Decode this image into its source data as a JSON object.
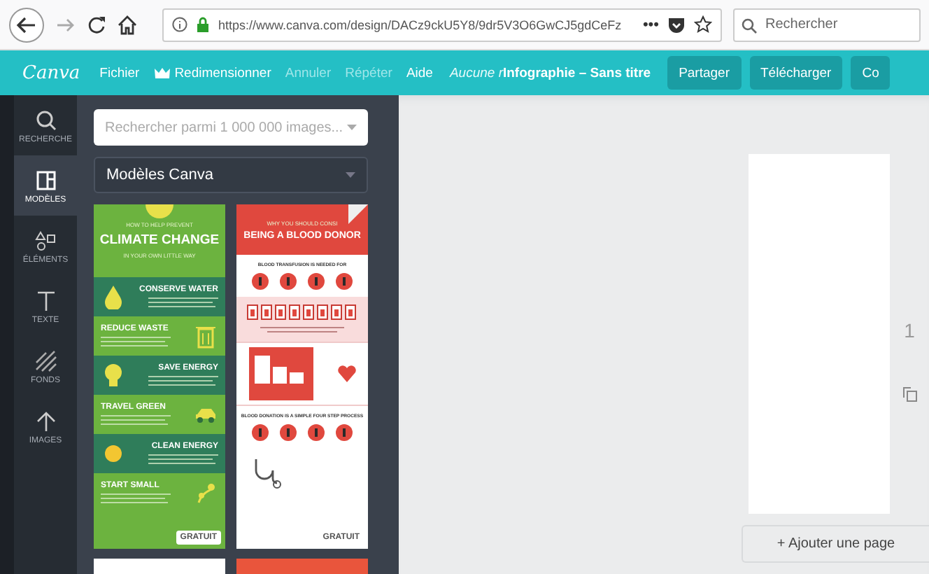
{
  "browser": {
    "url": "https://www.canva.com/design/DACz9ckU5Y8/9dr5V3O6GwCJ5gdCeFz",
    "more": "•••",
    "search": {
      "placeholder": "Rechercher"
    }
  },
  "header": {
    "logo": "Canva",
    "menu": [
      {
        "label": "Fichier",
        "disabled": false,
        "kind": "text"
      },
      {
        "label": "Redimensionner",
        "disabled": false,
        "kind": "crown"
      },
      {
        "label": "Annuler",
        "disabled": true,
        "kind": "text"
      },
      {
        "label": "Répéter",
        "disabled": true,
        "kind": "text"
      },
      {
        "label": "Aide",
        "disabled": false,
        "kind": "text"
      }
    ],
    "hint": "Aucune r",
    "title": "Infographie – Sans titre",
    "buttons": [
      "Partager",
      "Télécharger",
      "Co"
    ]
  },
  "sidebar": {
    "items": [
      {
        "label": "RECHERCHE",
        "kind": "search",
        "selected": false
      },
      {
        "label": "MODÈLES",
        "kind": "layout",
        "selected": true
      },
      {
        "label": "ÉLÉMENTS",
        "kind": "shapes",
        "selected": false
      },
      {
        "label": "TEXTE",
        "kind": "text",
        "selected": false
      },
      {
        "label": "FONDS",
        "kind": "hatch",
        "selected": false
      },
      {
        "label": "IMAGES",
        "kind": "upload",
        "selected": false
      }
    ]
  },
  "panel": {
    "search": {
      "placeholder": "Rechercher parmi 1 000 000 images..."
    },
    "category": "Modèles Canva",
    "templates": [
      {
        "kind": "climate",
        "pre": "HOW TO HELP PREVENT",
        "title": "CLIMATE CHANGE",
        "sub": "IN YOUR OWN LITTLE WAY",
        "sections": [
          "CONSERVE WATER",
          "REDUCE WASTE",
          "SAVE ENERGY",
          "TRAVEL GREEN",
          "CLEAN ENERGY",
          "START SMALL"
        ],
        "badge": "GRATUIT"
      },
      {
        "kind": "blood",
        "pre": "WHY YOU SHOULD CONSI",
        "title": "BEING A BLOOD DONOR",
        "sections": [
          "BLOOD TRANSFUSION IS NEEDED FOR",
          "BLOOD DONATION IS A SIMPLE FOUR STEP PROCESS"
        ],
        "badge": "GRATUIT"
      },
      {
        "kind": "plain"
      },
      {
        "kind": "red"
      }
    ]
  },
  "editor": {
    "page_number": "1",
    "add_page": "+ Ajouter une page"
  }
}
